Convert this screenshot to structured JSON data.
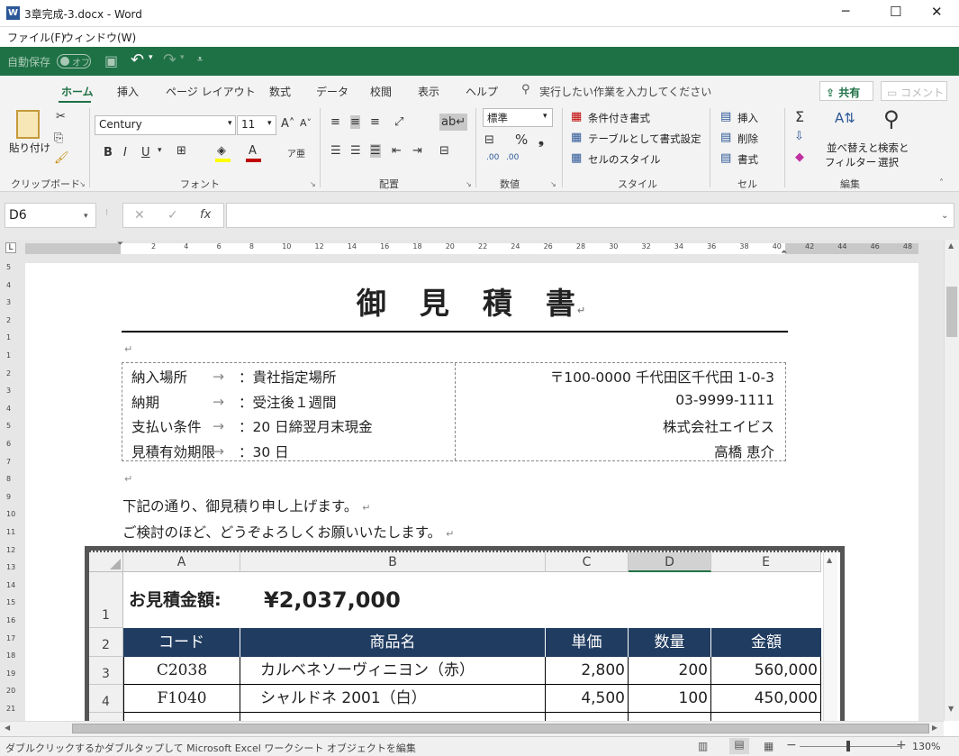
{
  "window": {
    "title": "3章完成-3.docx - Word",
    "minimize": "─",
    "maximize": "☐",
    "close": "✕"
  },
  "menu": [
    "ファイル(F)",
    "ウィンドウ(W)"
  ],
  "qat": {
    "autosave": "自動保存",
    "autosave_state": "オフ"
  },
  "tabs": [
    "ホーム",
    "挿入",
    "ページ レイアウト",
    "数式",
    "データ",
    "校閲",
    "表示",
    "ヘルプ"
  ],
  "tell_me": "実行したい作業を入力してください",
  "share": "共有",
  "comment": "コメント",
  "ribbon": {
    "paste": "貼り付け",
    "clipboard": "クリップボード",
    "font_name": "Century",
    "font_size": "11",
    "font_group": "フォント",
    "align_group": "配置",
    "number_format": "標準",
    "number_group": "数値",
    "cond_format": "条件付き書式",
    "table_format": "テーブルとして書式設定",
    "cell_style": "セルのスタイル",
    "style_group": "スタイル",
    "insert": "挿入",
    "delete": "削除",
    "format": "書式",
    "cells_group": "セル",
    "sort_filter_1": "並べ替えと",
    "sort_filter_2": "フィルター",
    "find_1": "検索と",
    "find_2": "選択",
    "edit_group": "編集"
  },
  "formula_bar": {
    "name_box": "D6",
    "value": ""
  },
  "ruler_ticks": [
    "2",
    "4",
    "6",
    "8",
    "10",
    "12",
    "14",
    "16",
    "18",
    "20",
    "22",
    "24",
    "26",
    "28",
    "30",
    "32",
    "34",
    "36",
    "38",
    "40",
    "42",
    "44",
    "46",
    "48"
  ],
  "vruler": [
    "5",
    "4",
    "3",
    "2",
    "1",
    "1",
    "2",
    "3",
    "4",
    "5",
    "6",
    "7",
    "8",
    "9",
    "10",
    "11",
    "12",
    "13",
    "14",
    "15",
    "16",
    "17",
    "18",
    "19",
    "20",
    "21"
  ],
  "document": {
    "title": "御　見　積　書",
    "info_left": [
      {
        "label": "納入場所",
        "value": "：貴社指定場所"
      },
      {
        "label": "納期",
        "value": "：受注後１週間"
      },
      {
        "label": "支払い条件",
        "value": "：20 日締翌月末現金"
      },
      {
        "label": "見積有効期限",
        "value": "：30 日"
      }
    ],
    "info_right": [
      "〒100-0000 千代田区千代田 1-0-3",
      "03-9999-1111",
      "株式会社エイビス",
      "高橋 恵介"
    ],
    "line1": "下記の通り、御見積り申し上げます。",
    "line2": "ご検討のほど、どうぞよろしくお願いいたします。"
  },
  "excel": {
    "col_headers": [
      "A",
      "B",
      "C",
      "D",
      "E"
    ],
    "row_headers": [
      "1",
      "2",
      "3",
      "4"
    ],
    "amount_label": "お見積金額:",
    "amount_value": "¥2,037,000",
    "headers": [
      "コード",
      "商品名",
      "単価",
      "数量",
      "金額"
    ],
    "rows": [
      [
        "C2038",
        "カルベネソーヴィニヨン（赤）",
        "2,800",
        "200",
        "560,000"
      ],
      [
        "F1040",
        "シャルドネ 2001（白）",
        "4,500",
        "100",
        "450,000"
      ]
    ],
    "header_color": "#203c60"
  },
  "status": {
    "text": "ダブルクリックするかダブルタップして Microsoft Excel ワークシート オブジェクトを編集",
    "zoom": "130%"
  },
  "colors": {
    "accent": "#1e7145",
    "tab_active": "#1e7145"
  }
}
